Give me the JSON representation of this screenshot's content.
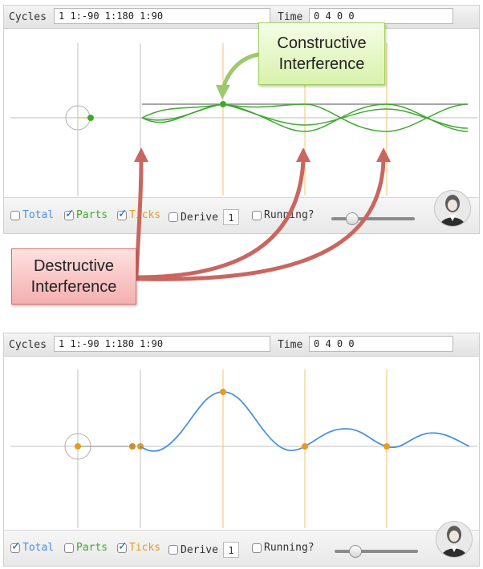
{
  "colors": {
    "total": "#4a90e2",
    "parts": "#3fa82f",
    "ticks": "#e79b1f",
    "axis": "#c2c2c2",
    "guide": "#f3c46a",
    "callout_green_border": "#9fd05a",
    "arrow_green": "#9cc96b",
    "arrow_red": "#c9665f"
  },
  "panels": [
    {
      "cycles_label": "Cycles",
      "cycles_value": "1 1:-90 1:180 1:90",
      "time_label": "Time",
      "time_value": "0 4 0 0",
      "controls": {
        "total_label": "Total",
        "total_checked": false,
        "parts_label": "Parts",
        "parts_checked": true,
        "ticks_label": "Ticks",
        "ticks_checked": true,
        "derive_label": "Derive",
        "derive_checked": false,
        "derive_value": "1",
        "running_label": "Running?",
        "running_checked": false,
        "slider_value": 0.3
      },
      "avatar_icon": "portrait-icon"
    },
    {
      "cycles_label": "Cycles",
      "cycles_value": "1 1:-90 1:180 1:90",
      "time_label": "Time",
      "time_value": "0 4 0 0",
      "controls": {
        "total_label": "Total",
        "total_checked": true,
        "parts_label": "Parts",
        "parts_checked": false,
        "ticks_label": "Ticks",
        "ticks_checked": true,
        "derive_label": "Derive",
        "derive_checked": false,
        "derive_value": "1",
        "running_label": "Running?",
        "running_checked": false,
        "slider_value": 0.3
      },
      "avatar_icon": "portrait-icon"
    }
  ],
  "annotations": {
    "constructive": "Constructive Interference",
    "destructive": "Destructive Interference"
  }
}
